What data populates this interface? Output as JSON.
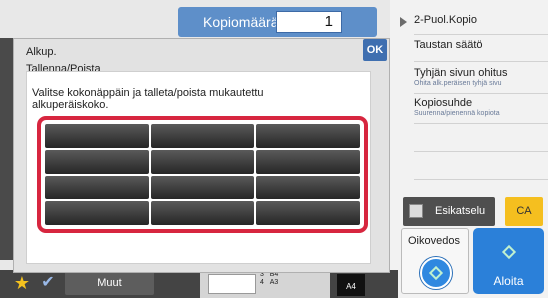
{
  "header": {
    "copy_label": "Kopiomäärä",
    "copy_value": "1"
  },
  "dialog": {
    "title": "Alkup.",
    "subtitle": "Tallenna/Poista",
    "ok_label": "OK",
    "instruction": "Valitse kokonäppäin ja talleta/poista mukautettu alkuperäiskoko.",
    "size_keys": [
      {
        "label": ""
      },
      {
        "label": ""
      },
      {
        "label": ""
      },
      {
        "label": ""
      },
      {
        "label": ""
      },
      {
        "label": ""
      },
      {
        "label": ""
      },
      {
        "label": ""
      },
      {
        "label": ""
      },
      {
        "label": ""
      },
      {
        "label": ""
      },
      {
        "label": ""
      }
    ]
  },
  "right_panel": {
    "items": [
      {
        "title": "2-Puol.Kopio",
        "sub": ""
      },
      {
        "title": "Taustan säätö",
        "sub": ""
      },
      {
        "title": "Tyhjän sivun ohitus",
        "sub": "Ohita alk.peräisen tyhjä sivu"
      },
      {
        "title": "Kopiosuhde",
        "sub": "Suurenna/pienennä kopiota"
      }
    ],
    "preview_label": "Esikatselu",
    "ca_label": "CA",
    "proof_label": "Oikovedos",
    "start_label": "Aloita"
  },
  "bottom": {
    "other_label": "Muut",
    "tray_sizes": [
      "3",
      "B4",
      "4",
      "A3"
    ],
    "paper_size": "A4"
  },
  "colors": {
    "accent": "#5e8fc9",
    "highlight": "#d7263f",
    "start": "#2b80d9",
    "ca": "#f5bf1f"
  }
}
